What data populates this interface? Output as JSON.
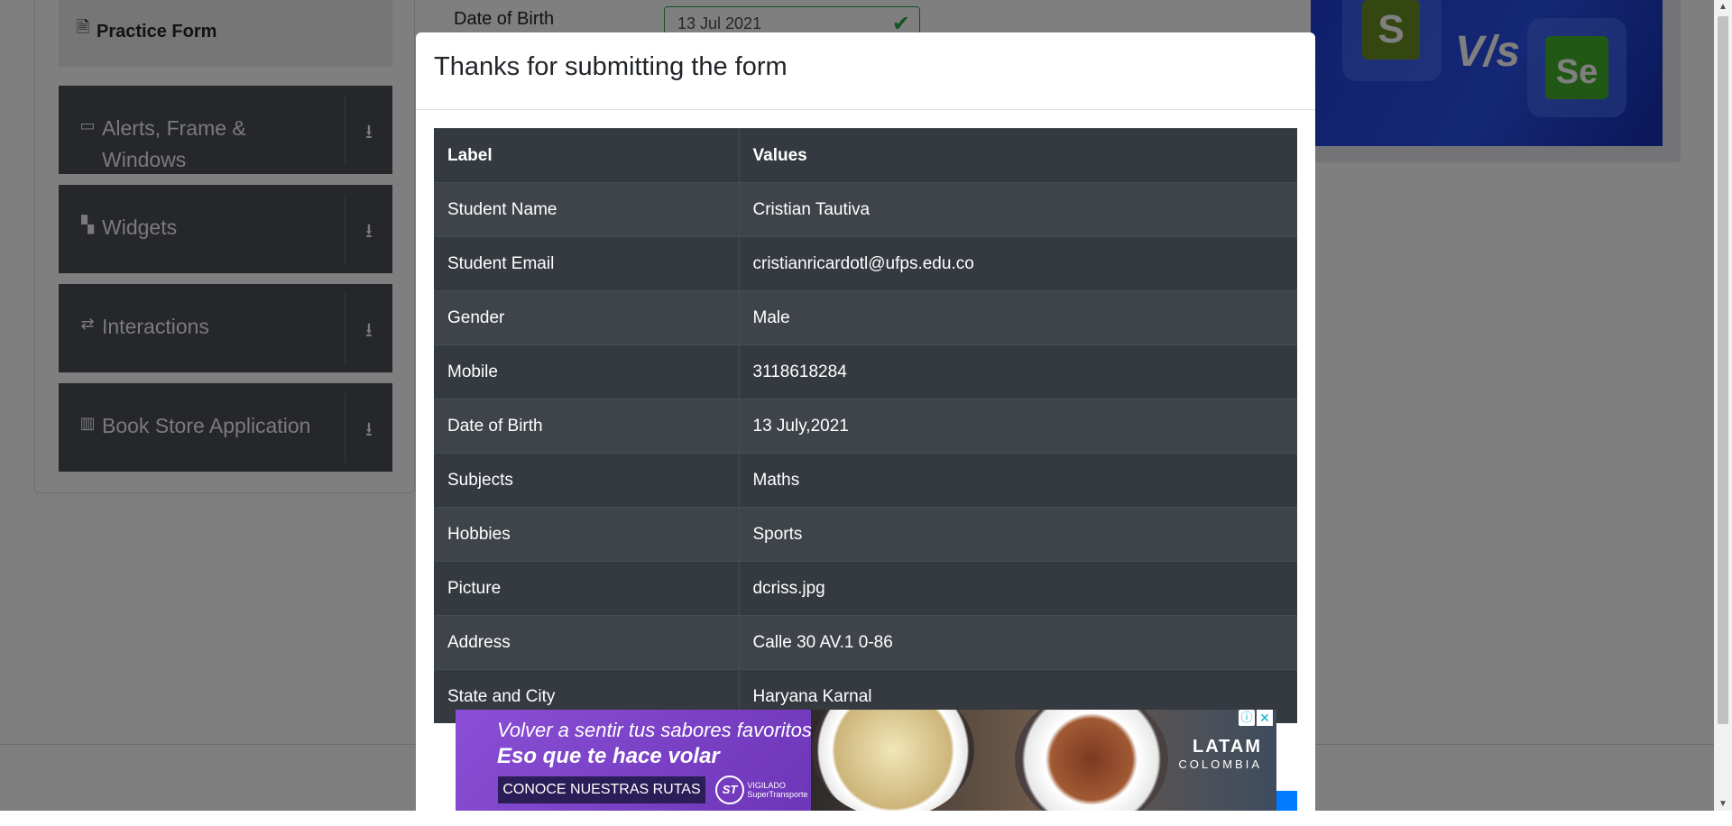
{
  "sidebar": {
    "active_item": {
      "label": "Practice Form",
      "icon": "form-icon"
    },
    "items": [
      {
        "label_line1": "Alerts, Frame &",
        "label_line2": "Windows",
        "icon": "window-icon"
      },
      {
        "label": "Widgets",
        "icon": "widgets-icon"
      },
      {
        "label": "Interactions",
        "icon": "interactions-icon"
      },
      {
        "label": "Book Store Application",
        "icon": "books-icon"
      }
    ],
    "download_glyph": "⭳"
  },
  "form": {
    "dob_label": "Date of Birth",
    "dob_value": "13 Jul 2021"
  },
  "modal": {
    "title": "Thanks for submitting the form",
    "table": {
      "headers": [
        "Label",
        "Values"
      ],
      "rows": [
        [
          "Student Name",
          "Cristian Tautiva"
        ],
        [
          "Student Email",
          "cristianricardotl@ufps.edu.co"
        ],
        [
          "Gender",
          "Male"
        ],
        [
          "Mobile",
          "3118618284"
        ],
        [
          "Date of Birth",
          "13 July,2021"
        ],
        [
          "Subjects",
          "Maths"
        ],
        [
          "Hobbies",
          "Sports"
        ],
        [
          "Picture",
          "dcriss.jpg"
        ],
        [
          "Address",
          "Calle 30 AV.1 0-86"
        ],
        [
          "State and City",
          "Haryana Karnal"
        ]
      ]
    }
  },
  "ad": {
    "line1": "Volver a sentir tus sabores favoritos",
    "line2": "Eso que te hace volar",
    "cta": "CONOCE NUESTRAS RUTAS",
    "st_badge": "ST",
    "st_caption": "VIGILADO SuperTransporte",
    "brand": "LATAM",
    "brand_sub": "COLOMBIA",
    "info_glyph": "ⓘ",
    "close_glyph": "✕"
  },
  "colors": {
    "sidebar_bg": "#4a4e55",
    "table_bg": "#343a40",
    "success": "#28a745",
    "primary": "#007bff",
    "ad_purple": "#6d35b8"
  }
}
